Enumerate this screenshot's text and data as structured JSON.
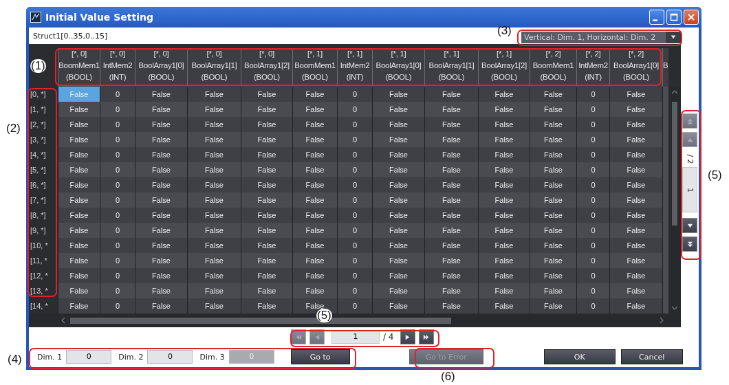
{
  "window": {
    "title": "Initial Value Setting"
  },
  "variable": "Struct1[0..35,0..15]",
  "orientation_dropdown": {
    "value": "Vertical: Dim. 1, Horizontal: Dim. 2"
  },
  "table": {
    "columns": [
      {
        "index": "[*, 0]",
        "member": "BoomMem1",
        "type": "(BOOL)"
      },
      {
        "index": "[*, 0]",
        "member": "IntMem2",
        "type": "(INT)"
      },
      {
        "index": "[*, 0]",
        "member": "BoolArray1[0]",
        "type": "(BOOL)"
      },
      {
        "index": "[*, 0]",
        "member": "BoolArray1[1]",
        "type": "(BOOL)"
      },
      {
        "index": "[*, 0]",
        "member": "BoolArray1[2]",
        "type": "(BOOL)"
      },
      {
        "index": "[*, 1]",
        "member": "BoomMem1",
        "type": "(BOOL)"
      },
      {
        "index": "[*, 1]",
        "member": "IntMem2",
        "type": "(INT)"
      },
      {
        "index": "[*, 1]",
        "member": "BoolArray1[0]",
        "type": "(BOOL)"
      },
      {
        "index": "[*, 1]",
        "member": "BoolArray1[1]",
        "type": "(BOOL)"
      },
      {
        "index": "[*, 1]",
        "member": "BoolArray1[2]",
        "type": "(BOOL)"
      },
      {
        "index": "[*, 2]",
        "member": "BoomMem1",
        "type": "(BOOL)"
      },
      {
        "index": "[*, 2]",
        "member": "IntMem2",
        "type": "(INT)"
      },
      {
        "index": "[*, 2]",
        "member": "BoolArray1[0]",
        "type": "(BOOL)"
      },
      {
        "member": "B"
      }
    ],
    "rows": [
      {
        "label": "[0, *]",
        "cells": [
          {
            "value": "False",
            "selected": true
          },
          {
            "value": "0",
            "selected": false
          },
          {
            "value": "False",
            "selected": false
          },
          {
            "value": "False",
            "selected": false
          },
          {
            "value": "False",
            "selected": false
          },
          {
            "value": "False",
            "selected": false
          },
          {
            "value": "0",
            "selected": false
          },
          {
            "value": "False",
            "selected": false
          },
          {
            "value": "False",
            "selected": false
          },
          {
            "value": "False",
            "selected": false
          },
          {
            "value": "False",
            "selected": false
          },
          {
            "value": "0",
            "selected": false
          },
          {
            "value": "False",
            "selected": false
          }
        ]
      },
      {
        "label": "[1, *]",
        "cells": [
          {
            "value": "False",
            "selected": false
          },
          {
            "value": "0",
            "selected": false
          },
          {
            "value": "False",
            "selected": false
          },
          {
            "value": "False",
            "selected": false
          },
          {
            "value": "False",
            "selected": false
          },
          {
            "value": "False",
            "selected": false
          },
          {
            "value": "0",
            "selected": false
          },
          {
            "value": "False",
            "selected": false
          },
          {
            "value": "False",
            "selected": false
          },
          {
            "value": "False",
            "selected": false
          },
          {
            "value": "False",
            "selected": false
          },
          {
            "value": "0",
            "selected": false
          },
          {
            "value": "False",
            "selected": false
          }
        ]
      },
      {
        "label": "[2, *]",
        "cells": [
          {
            "value": "False",
            "selected": false
          },
          {
            "value": "0",
            "selected": false
          },
          {
            "value": "False",
            "selected": false
          },
          {
            "value": "False",
            "selected": false
          },
          {
            "value": "False",
            "selected": false
          },
          {
            "value": "False",
            "selected": false
          },
          {
            "value": "0",
            "selected": false
          },
          {
            "value": "False",
            "selected": false
          },
          {
            "value": "False",
            "selected": false
          },
          {
            "value": "False",
            "selected": false
          },
          {
            "value": "False",
            "selected": false
          },
          {
            "value": "0",
            "selected": false
          },
          {
            "value": "False",
            "selected": false
          }
        ]
      },
      {
        "label": "[3, *]",
        "cells": [
          {
            "value": "False",
            "selected": false
          },
          {
            "value": "0",
            "selected": false
          },
          {
            "value": "False",
            "selected": false
          },
          {
            "value": "False",
            "selected": false
          },
          {
            "value": "False",
            "selected": false
          },
          {
            "value": "False",
            "selected": false
          },
          {
            "value": "0",
            "selected": false
          },
          {
            "value": "False",
            "selected": false
          },
          {
            "value": "False",
            "selected": false
          },
          {
            "value": "False",
            "selected": false
          },
          {
            "value": "False",
            "selected": false
          },
          {
            "value": "0",
            "selected": false
          },
          {
            "value": "False",
            "selected": false
          }
        ]
      },
      {
        "label": "[4, *]",
        "cells": [
          {
            "value": "False",
            "selected": false
          },
          {
            "value": "0",
            "selected": false
          },
          {
            "value": "False",
            "selected": false
          },
          {
            "value": "False",
            "selected": false
          },
          {
            "value": "False",
            "selected": false
          },
          {
            "value": "False",
            "selected": false
          },
          {
            "value": "0",
            "selected": false
          },
          {
            "value": "False",
            "selected": false
          },
          {
            "value": "False",
            "selected": false
          },
          {
            "value": "False",
            "selected": false
          },
          {
            "value": "False",
            "selected": false
          },
          {
            "value": "0",
            "selected": false
          },
          {
            "value": "False",
            "selected": false
          }
        ]
      },
      {
        "label": "[5, *]",
        "cells": [
          {
            "value": "False",
            "selected": false
          },
          {
            "value": "0",
            "selected": false
          },
          {
            "value": "False",
            "selected": false
          },
          {
            "value": "False",
            "selected": false
          },
          {
            "value": "False",
            "selected": false
          },
          {
            "value": "False",
            "selected": false
          },
          {
            "value": "0",
            "selected": false
          },
          {
            "value": "False",
            "selected": false
          },
          {
            "value": "False",
            "selected": false
          },
          {
            "value": "False",
            "selected": false
          },
          {
            "value": "False",
            "selected": false
          },
          {
            "value": "0",
            "selected": false
          },
          {
            "value": "False",
            "selected": false
          }
        ]
      },
      {
        "label": "[6, *]",
        "cells": [
          {
            "value": "False",
            "selected": false
          },
          {
            "value": "0",
            "selected": false
          },
          {
            "value": "False",
            "selected": false
          },
          {
            "value": "False",
            "selected": false
          },
          {
            "value": "False",
            "selected": false
          },
          {
            "value": "False",
            "selected": false
          },
          {
            "value": "0",
            "selected": false
          },
          {
            "value": "False",
            "selected": false
          },
          {
            "value": "False",
            "selected": false
          },
          {
            "value": "False",
            "selected": false
          },
          {
            "value": "False",
            "selected": false
          },
          {
            "value": "0",
            "selected": false
          },
          {
            "value": "False",
            "selected": false
          }
        ]
      },
      {
        "label": "[7, *]",
        "cells": [
          {
            "value": "False",
            "selected": false
          },
          {
            "value": "0",
            "selected": false
          },
          {
            "value": "False",
            "selected": false
          },
          {
            "value": "False",
            "selected": false
          },
          {
            "value": "False",
            "selected": false
          },
          {
            "value": "False",
            "selected": false
          },
          {
            "value": "0",
            "selected": false
          },
          {
            "value": "False",
            "selected": false
          },
          {
            "value": "False",
            "selected": false
          },
          {
            "value": "False",
            "selected": false
          },
          {
            "value": "False",
            "selected": false
          },
          {
            "value": "0",
            "selected": false
          },
          {
            "value": "False",
            "selected": false
          }
        ]
      },
      {
        "label": "[8, *]",
        "cells": [
          {
            "value": "False",
            "selected": false
          },
          {
            "value": "0",
            "selected": false
          },
          {
            "value": "False",
            "selected": false
          },
          {
            "value": "False",
            "selected": false
          },
          {
            "value": "False",
            "selected": false
          },
          {
            "value": "False",
            "selected": false
          },
          {
            "value": "0",
            "selected": false
          },
          {
            "value": "False",
            "selected": false
          },
          {
            "value": "False",
            "selected": false
          },
          {
            "value": "False",
            "selected": false
          },
          {
            "value": "False",
            "selected": false
          },
          {
            "value": "0",
            "selected": false
          },
          {
            "value": "False",
            "selected": false
          }
        ]
      },
      {
        "label": "[9, *]",
        "cells": [
          {
            "value": "False",
            "selected": false
          },
          {
            "value": "0",
            "selected": false
          },
          {
            "value": "False",
            "selected": false
          },
          {
            "value": "False",
            "selected": false
          },
          {
            "value": "False",
            "selected": false
          },
          {
            "value": "False",
            "selected": false
          },
          {
            "value": "0",
            "selected": false
          },
          {
            "value": "False",
            "selected": false
          },
          {
            "value": "False",
            "selected": false
          },
          {
            "value": "False",
            "selected": false
          },
          {
            "value": "False",
            "selected": false
          },
          {
            "value": "0",
            "selected": false
          },
          {
            "value": "False",
            "selected": false
          }
        ]
      },
      {
        "label": "[10, *",
        "cells": [
          {
            "value": "False",
            "selected": false
          },
          {
            "value": "0",
            "selected": false
          },
          {
            "value": "False",
            "selected": false
          },
          {
            "value": "False",
            "selected": false
          },
          {
            "value": "False",
            "selected": false
          },
          {
            "value": "False",
            "selected": false
          },
          {
            "value": "0",
            "selected": false
          },
          {
            "value": "False",
            "selected": false
          },
          {
            "value": "False",
            "selected": false
          },
          {
            "value": "False",
            "selected": false
          },
          {
            "value": "False",
            "selected": false
          },
          {
            "value": "0",
            "selected": false
          },
          {
            "value": "False",
            "selected": false
          }
        ]
      },
      {
        "label": "[11, *",
        "cells": [
          {
            "value": "False",
            "selected": false
          },
          {
            "value": "0",
            "selected": false
          },
          {
            "value": "False",
            "selected": false
          },
          {
            "value": "False",
            "selected": false
          },
          {
            "value": "False",
            "selected": false
          },
          {
            "value": "False",
            "selected": false
          },
          {
            "value": "0",
            "selected": false
          },
          {
            "value": "False",
            "selected": false
          },
          {
            "value": "False",
            "selected": false
          },
          {
            "value": "False",
            "selected": false
          },
          {
            "value": "False",
            "selected": false
          },
          {
            "value": "0",
            "selected": false
          },
          {
            "value": "False",
            "selected": false
          }
        ]
      },
      {
        "label": "[12, *",
        "cells": [
          {
            "value": "False",
            "selected": false
          },
          {
            "value": "0",
            "selected": false
          },
          {
            "value": "False",
            "selected": false
          },
          {
            "value": "False",
            "selected": false
          },
          {
            "value": "False",
            "selected": false
          },
          {
            "value": "False",
            "selected": false
          },
          {
            "value": "0",
            "selected": false
          },
          {
            "value": "False",
            "selected": false
          },
          {
            "value": "False",
            "selected": false
          },
          {
            "value": "False",
            "selected": false
          },
          {
            "value": "False",
            "selected": false
          },
          {
            "value": "0",
            "selected": false
          },
          {
            "value": "False",
            "selected": false
          }
        ]
      },
      {
        "label": "[13, *",
        "cells": [
          {
            "value": "False",
            "selected": false
          },
          {
            "value": "0",
            "selected": false
          },
          {
            "value": "False",
            "selected": false
          },
          {
            "value": "False",
            "selected": false
          },
          {
            "value": "False",
            "selected": false
          },
          {
            "value": "False",
            "selected": false
          },
          {
            "value": "0",
            "selected": false
          },
          {
            "value": "False",
            "selected": false
          },
          {
            "value": "False",
            "selected": false
          },
          {
            "value": "False",
            "selected": false
          },
          {
            "value": "False",
            "selected": false
          },
          {
            "value": "0",
            "selected": false
          },
          {
            "value": "False",
            "selected": false
          }
        ]
      },
      {
        "label": "[14, *",
        "cells": [
          {
            "value": "False",
            "selected": false
          },
          {
            "value": "0",
            "selected": false
          },
          {
            "value": "False",
            "selected": false
          },
          {
            "value": "False",
            "selected": false
          },
          {
            "value": "False",
            "selected": false
          },
          {
            "value": "False",
            "selected": false
          },
          {
            "value": "0",
            "selected": false
          },
          {
            "value": "False",
            "selected": false
          },
          {
            "value": "False",
            "selected": false
          },
          {
            "value": "False",
            "selected": false
          },
          {
            "value": "False",
            "selected": false
          },
          {
            "value": "0",
            "selected": false
          },
          {
            "value": "False",
            "selected": false
          }
        ]
      }
    ]
  },
  "horizontal_pager": {
    "page": "1",
    "total": "/ 4",
    "buttons": [
      {
        "kind": "first",
        "disabled": true
      },
      {
        "kind": "prev",
        "disabled": true
      },
      {
        "kind": "next",
        "disabled": false
      },
      {
        "kind": "last",
        "disabled": false
      }
    ]
  },
  "vertical_pager": {
    "page": "1",
    "total": "/ 2",
    "buttons": [
      {
        "kind": "first",
        "disabled": true
      },
      {
        "kind": "prev",
        "disabled": true
      },
      {
        "kind": "next",
        "disabled": false
      },
      {
        "kind": "last",
        "disabled": false
      }
    ]
  },
  "goto": {
    "fields": [
      {
        "label": "Dim. 1",
        "value": "0",
        "disabled": false
      },
      {
        "label": "Dim. 2",
        "value": "0",
        "disabled": false
      },
      {
        "label": "Dim. 3",
        "value": "0",
        "disabled": true
      }
    ],
    "button": {
      "label": "Go to",
      "disabled": false
    }
  },
  "buttons": [
    {
      "label": "Go to Error",
      "disabled": true
    },
    {
      "label": "OK",
      "disabled": false
    },
    {
      "label": "Cancel",
      "disabled": false
    }
  ],
  "annotations": [
    {
      "label": "(1)"
    },
    {
      "label": "(2)"
    },
    {
      "label": "(3)"
    },
    {
      "label": "(4)"
    },
    {
      "label": "(5)"
    },
    {
      "label": "(5)"
    },
    {
      "label": "(6)"
    }
  ]
}
